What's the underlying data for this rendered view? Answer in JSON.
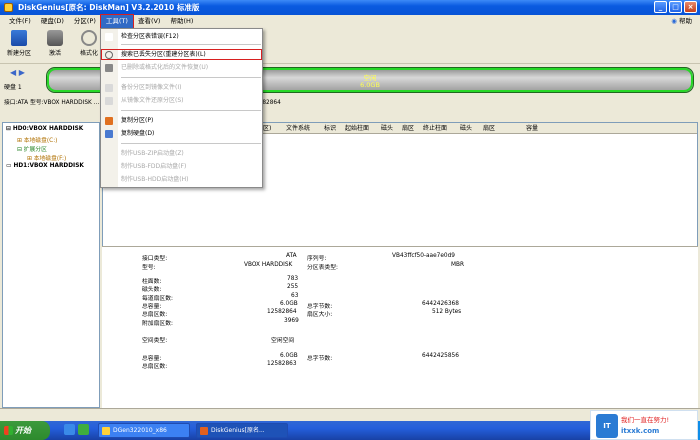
{
  "window": {
    "title": "DiskGenius[原名: DiskMan] V3.2.2010 标准版",
    "buttons": [
      "_",
      "□",
      "×"
    ]
  },
  "menubar": {
    "items": [
      "文件(F)",
      "硬盘(D)",
      "分区(P)",
      "工具(T)",
      "查看(V)",
      "帮助(H)"
    ],
    "help_right": "帮助"
  },
  "toolbar": {
    "items": [
      {
        "label": "新建分区",
        "icon": "new-partition-icon"
      },
      {
        "label": "激活",
        "icon": "activate-icon"
      },
      {
        "label": "格式化",
        "icon": "format-icon"
      },
      {
        "label": "",
        "icon": "cut-icon"
      }
    ]
  },
  "disk": {
    "label": "硬盘 1",
    "partition_name": "空闲",
    "partition_size": "6.0GB",
    "info_line": "接口:ATA  型号:VBOX HARDDISK  ... 43MB)  柱面数:783  磁头数:255  每道扇区数:63  总扇区数:12582864"
  },
  "tree": {
    "nodes": [
      "HD0:VBOX HARDDISK",
      "本地磁盘(C:)",
      "扩展分区",
      "本地磁盘(F:)",
      "HD1:VBOX HARDDISK"
    ]
  },
  "partition_table": {
    "columns": [
      "区)",
      "文件系统",
      "标识",
      "起始柱面",
      "磁头",
      "扇区",
      "终止柱面",
      "磁头",
      "扇区",
      "容量"
    ]
  },
  "details": {
    "interface_label": "接口类型:",
    "interface_value": "ATA",
    "serial_label": "序列号:",
    "serial_value": "VB43ffcf50-aae7e0d9",
    "model_label": "型号:",
    "model_value": "VBOX HARDDISK",
    "pt_label": "分区表类型:",
    "pt_value": "MBR",
    "cyl_label": "柱面数:",
    "cyl_value": "783",
    "heads_label": "磁头数:",
    "heads_value": "255",
    "spt_label": "每道扇区数:",
    "spt_value": "63",
    "cap_label": "总容量:",
    "cap_value": "6.0GB",
    "bytes_label": "总字节数:",
    "bytes_value": "6442426368",
    "sectors_label": "总扇区数:",
    "sectors_value": "12582864",
    "secsize_label": "扇区大小:",
    "secsize_value": "512 Bytes",
    "extra_label": "附加扇区数:",
    "extra_value": "3969",
    "space_label": "空间类型:",
    "space_value": "空闲空间",
    "cap2_label": "总容量:",
    "cap2_value": "6.0GB",
    "bytes2_label": "总字节数:",
    "bytes2_value": "6442425856",
    "sectors2_label": "总扇区数:",
    "sectors2_value": "12582863"
  },
  "dropdown": {
    "items": [
      {
        "label": "检查分区表错误(F12)",
        "enabled": true
      },
      {
        "label": "搜索已丢失分区(重建分区表)(L)",
        "enabled": true,
        "highlight": true
      },
      {
        "label": "已删除或格式化后的文件恢复(U)",
        "enabled": false
      },
      {
        "label": "备份分区到镜像文件(I)",
        "enabled": false
      },
      {
        "label": "从镜像文件还原分区(S)",
        "enabled": false
      },
      {
        "label": "复制分区(P)",
        "enabled": true
      },
      {
        "label": "复制硬盘(D)",
        "enabled": true
      },
      {
        "label": "制作USB-ZIP启动盘(Z)",
        "enabled": false
      },
      {
        "label": "制作USB-FDD启动盘(F)",
        "enabled": false
      },
      {
        "label": "制作USB-HDD启动盘(H)",
        "enabled": false
      }
    ]
  },
  "taskbar": {
    "start": "开始",
    "tasks": [
      "DGen322010_x86",
      "DiskGenius[原名..."
    ]
  },
  "watermark": {
    "line1": "我们一直在努力!",
    "line2": "itxxk.com",
    "logo": "IT"
  }
}
